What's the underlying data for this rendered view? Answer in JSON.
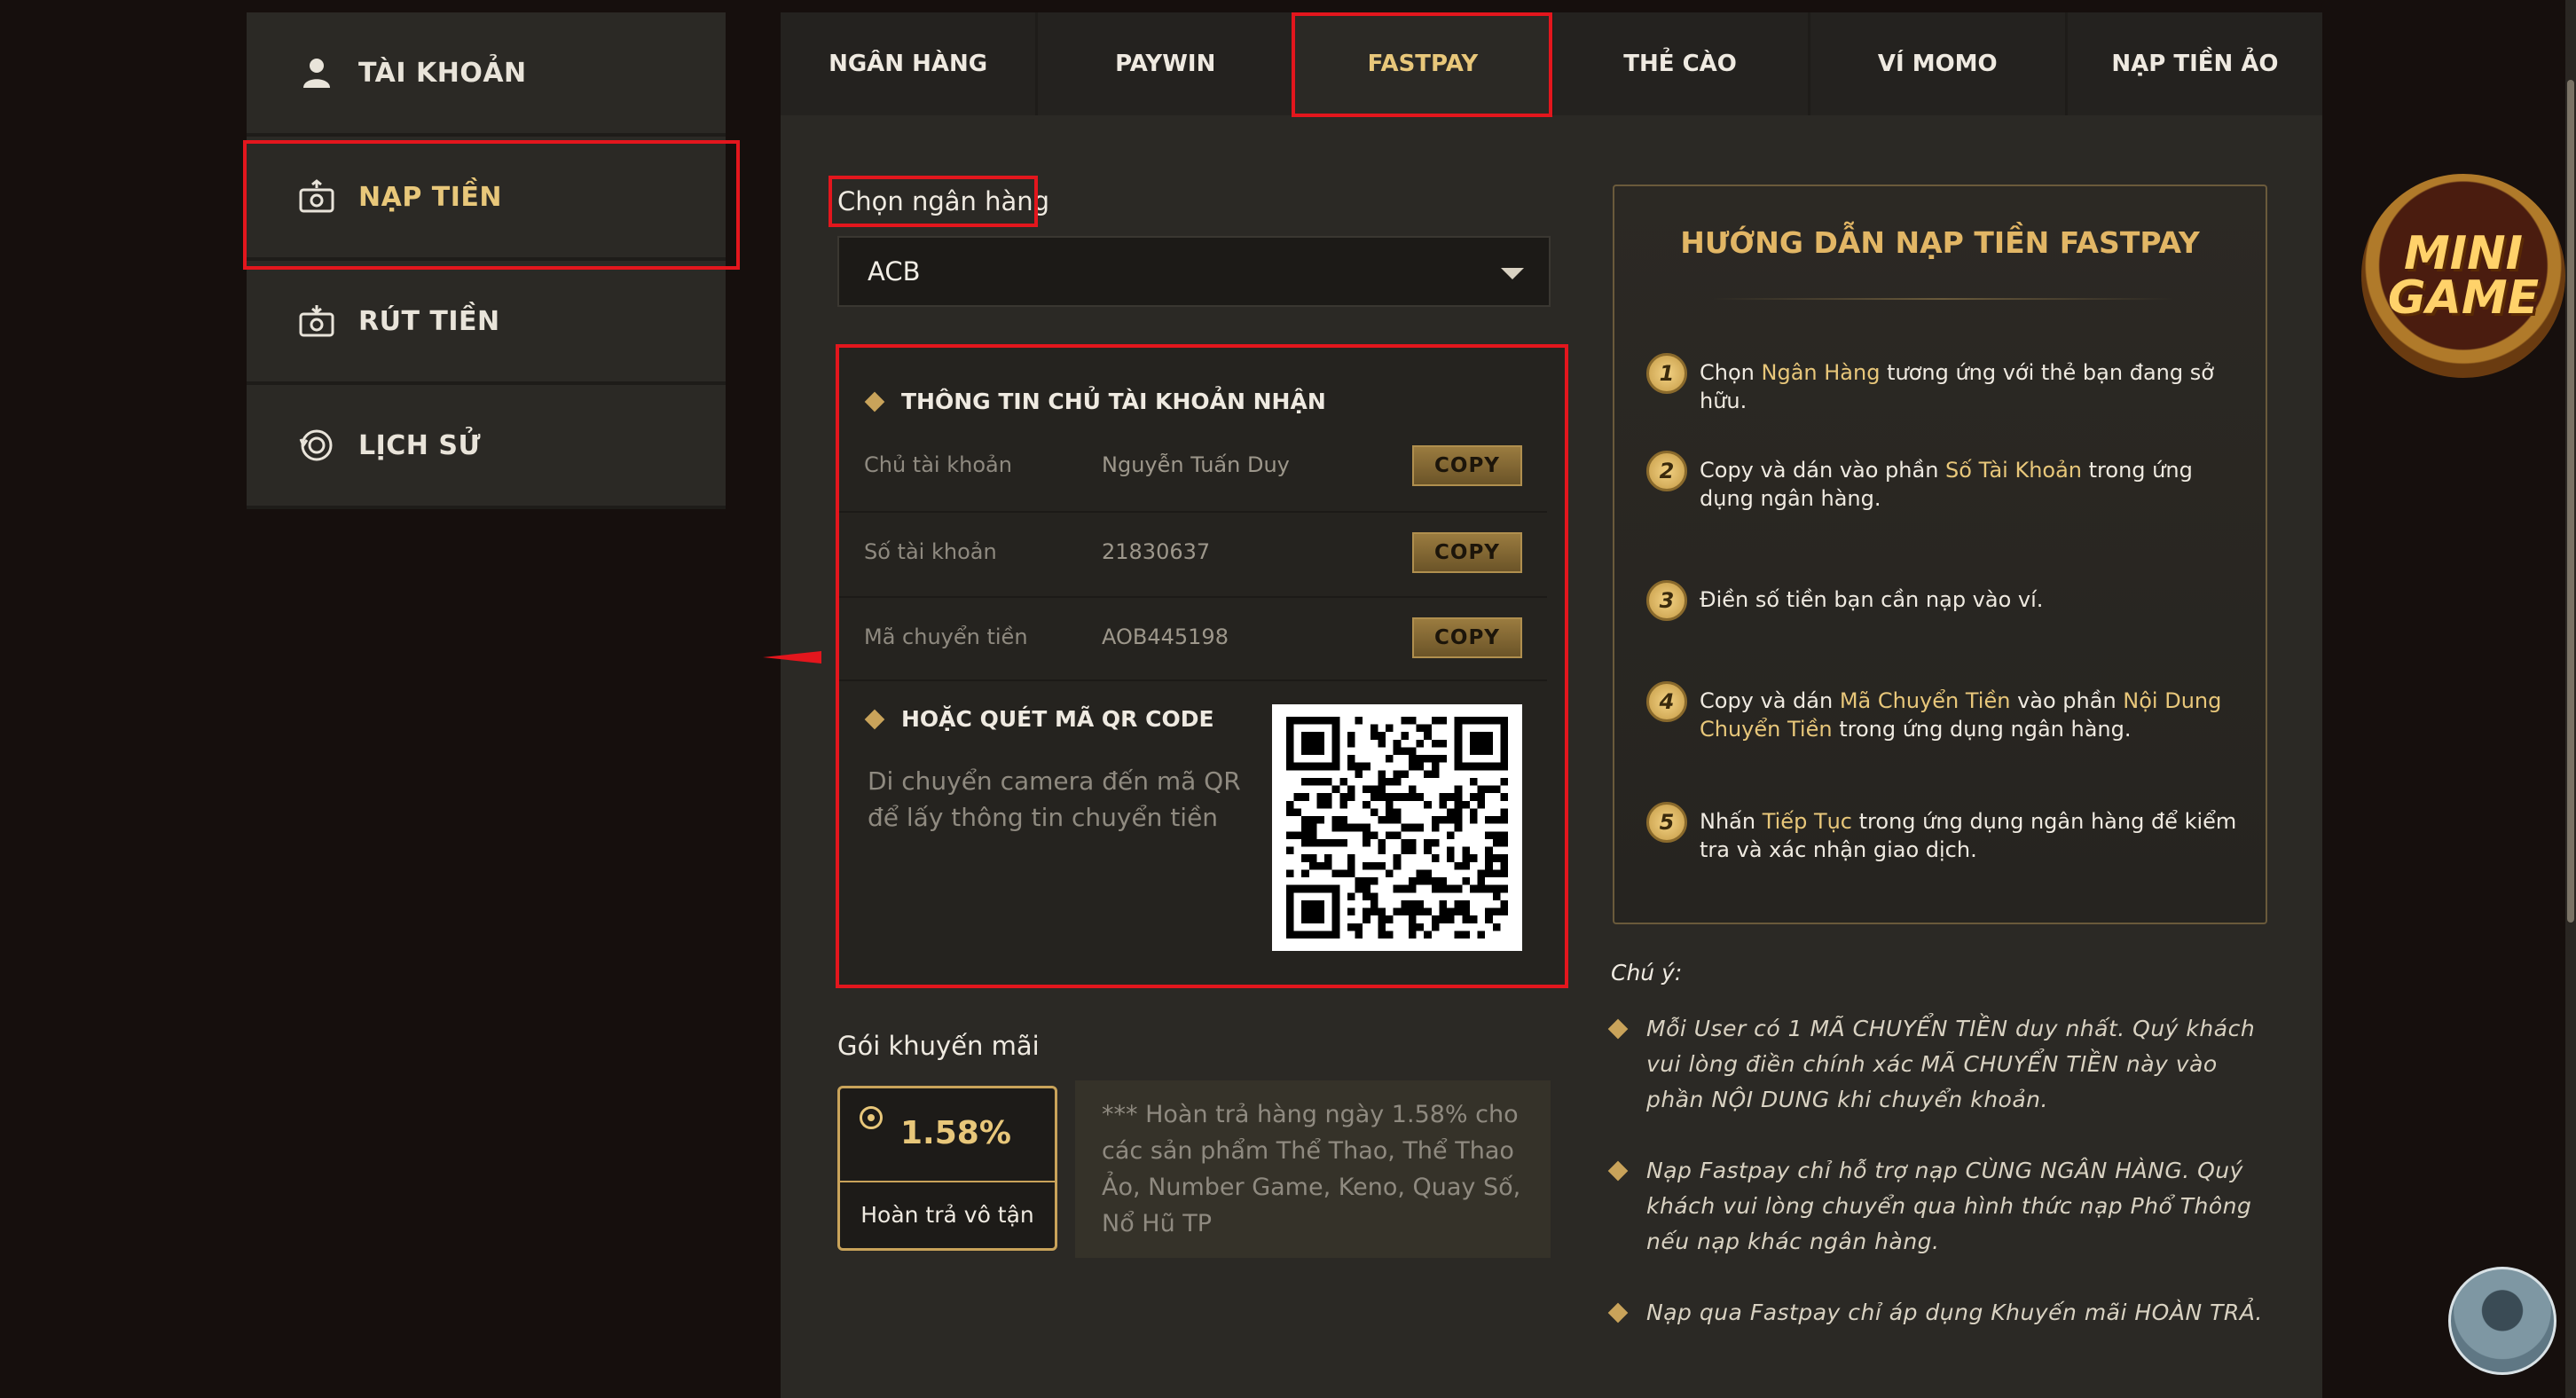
{
  "sidebar": {
    "items": [
      {
        "label": "TÀI KHOẢN",
        "icon": "user-icon"
      },
      {
        "label": "NẠP TIỀN",
        "icon": "deposit-icon"
      },
      {
        "label": "RÚT TIỀN",
        "icon": "withdraw-icon"
      },
      {
        "label": "LỊCH SỬ",
        "icon": "history-icon"
      }
    ],
    "active": "NẠP TIỀN"
  },
  "tabs": [
    "NGÂN HÀNG",
    "PAYWIN",
    "FASTPAY",
    "THẺ CÀO",
    "VÍ MOMO",
    "NẠP TIỀN ẢO"
  ],
  "active_tab": "FASTPAY",
  "bank": {
    "label": "Chọn ngân hàng",
    "selected": "ACB"
  },
  "account_info": {
    "title": "THÔNG TIN CHỦ TÀI KHOẢN NHẬN",
    "rows": [
      {
        "key": "Chủ tài khoản",
        "value": "Nguyễn Tuấn Duy",
        "button": "COPY"
      },
      {
        "key": "Số tài khoản",
        "value": "21830637",
        "button": "COPY"
      },
      {
        "key": "Mã chuyển tiền",
        "value": "AOB445198",
        "button": "COPY"
      }
    ]
  },
  "qr": {
    "title": "HOẶC QUÉT MÃ QR CODE",
    "line1": "Di chuyển camera đến mã QR",
    "line2": "để lấy thông tin chuyển tiền"
  },
  "promo": {
    "label": "Gói khuyến mãi",
    "percent": "1.58%",
    "name": "Hoàn trả vô tận",
    "description": "*** Hoàn trả hàng ngày 1.58% cho các sản phẩm Thể Thao, Thể Thao Ảo, Number Game, Keno, Quay Số, Nổ Hũ TP"
  },
  "guide": {
    "title": "HƯỚNG DẪN NẠP TIỀN FASTPAY",
    "steps": [
      {
        "n": "1",
        "a": "Chọn ",
        "b": "Ngân Hàng",
        "c": " tương ứng với thẻ bạn đang sở hữu.",
        "d": "",
        "e": ""
      },
      {
        "n": "2",
        "a": "Copy và dán vào phần ",
        "b": "Số Tài Khoản",
        "c": " trong ứng dụng ngân hàng.",
        "d": "",
        "e": ""
      },
      {
        "n": "3",
        "a": "Điền số tiền bạn cần nạp vào ví.",
        "b": "",
        "c": "",
        "d": "",
        "e": ""
      },
      {
        "n": "4",
        "a": "Copy và dán ",
        "b": "Mã Chuyển Tiền",
        "c": " vào phần ",
        "d": "Nội Dung Chuyển Tiền",
        "e": " trong ứng dụng ngân hàng."
      },
      {
        "n": "5",
        "a": "Nhấn ",
        "b": "Tiếp Tục",
        "c": " trong ứng dụng ngân hàng để kiểm tra và xác nhận giao dịch.",
        "d": "",
        "e": ""
      }
    ]
  },
  "notes": {
    "title": "Chú ý:",
    "items": [
      "Mỗi User có 1 MÃ CHUYỂN TIỀN duy nhất. Quý khách vui lòng điền chính xác MÃ CHUYỂN TIỀN này vào phần NỘI DUNG khi chuyển khoản.",
      "Nạp Fastpay chỉ hỗ trợ nạp CÙNG NGÂN HÀNG. Quý khách vui lòng chuyển qua hình thức nạp Phổ Thông nếu nạp khác ngân hàng.",
      "Nạp qua Fastpay chỉ áp dụng Khuyến mãi HOÀN TRẢ."
    ]
  },
  "logo": {
    "line1": "MINI",
    "line2": "GAME"
  },
  "colors": {
    "accent": "#e8c77a",
    "highlight_box": "#e3161d",
    "panel": "#2b2925",
    "background": "#160f0d"
  }
}
